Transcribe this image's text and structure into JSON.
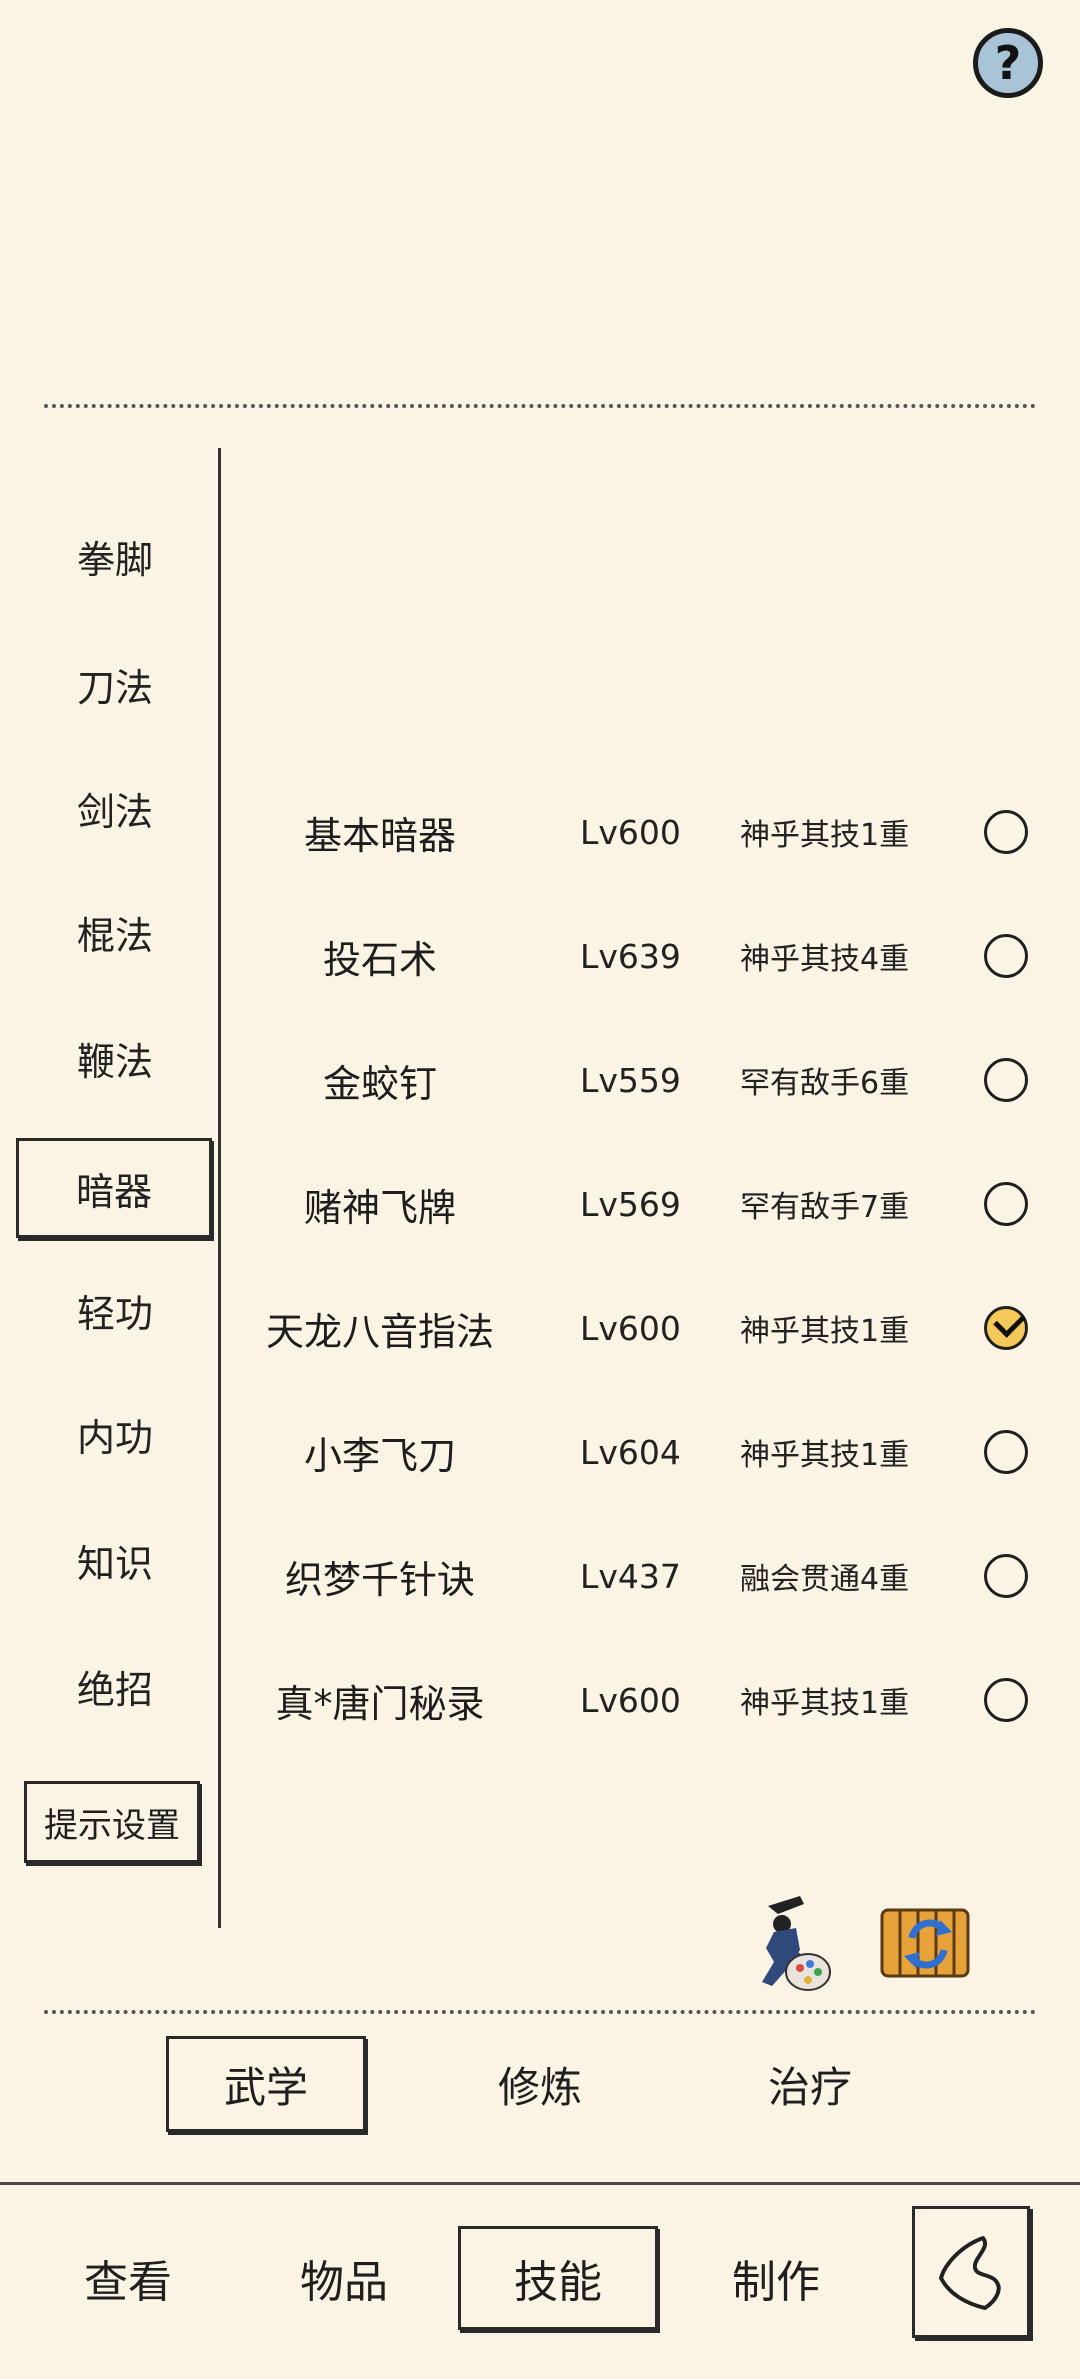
{
  "header": {
    "help_icon": "?"
  },
  "sidebar": {
    "items": [
      "拳脚",
      "刀法",
      "剑法",
      "棍法",
      "鞭法",
      "暗器",
      "轻功",
      "内功",
      "知识",
      "绝招"
    ],
    "active": "暗器",
    "hint_settings": "提示设置"
  },
  "skills": [
    {
      "name": "基本暗器",
      "level": "Lv600",
      "rank": "神乎其技1重",
      "selected": false
    },
    {
      "name": "投石术",
      "level": "Lv639",
      "rank": "神乎其技4重",
      "selected": false
    },
    {
      "name": "金蛟钉",
      "level": "Lv559",
      "rank": "罕有敌手6重",
      "selected": false
    },
    {
      "name": "赌神飞牌",
      "level": "Lv569",
      "rank": "罕有敌手7重",
      "selected": false
    },
    {
      "name": "天龙八音指法",
      "level": "Lv600",
      "rank": "神乎其技1重",
      "selected": true
    },
    {
      "name": "小李飞刀",
      "level": "Lv604",
      "rank": "神乎其技1重",
      "selected": false
    },
    {
      "name": "织梦千针诀",
      "level": "Lv437",
      "rank": "融会贯通4重",
      "selected": false
    },
    {
      "name": "真*唐门秘录",
      "level": "Lv600",
      "rank": "神乎其技1重",
      "selected": false
    }
  ],
  "tools": {
    "icons": [
      "martial-art-palette-icon",
      "scroll-refresh-icon"
    ]
  },
  "subtabs": {
    "items": [
      "武学",
      "修炼",
      "治疗"
    ],
    "active": "武学"
  },
  "bottom_nav": {
    "items": [
      "查看",
      "物品",
      "技能",
      "制作"
    ],
    "active": "技能",
    "back_icon": "back-icon"
  },
  "colors": {
    "background": "#fbf3e4",
    "check_fill": "#f4c95a",
    "help_fill": "#a9c4d6"
  }
}
